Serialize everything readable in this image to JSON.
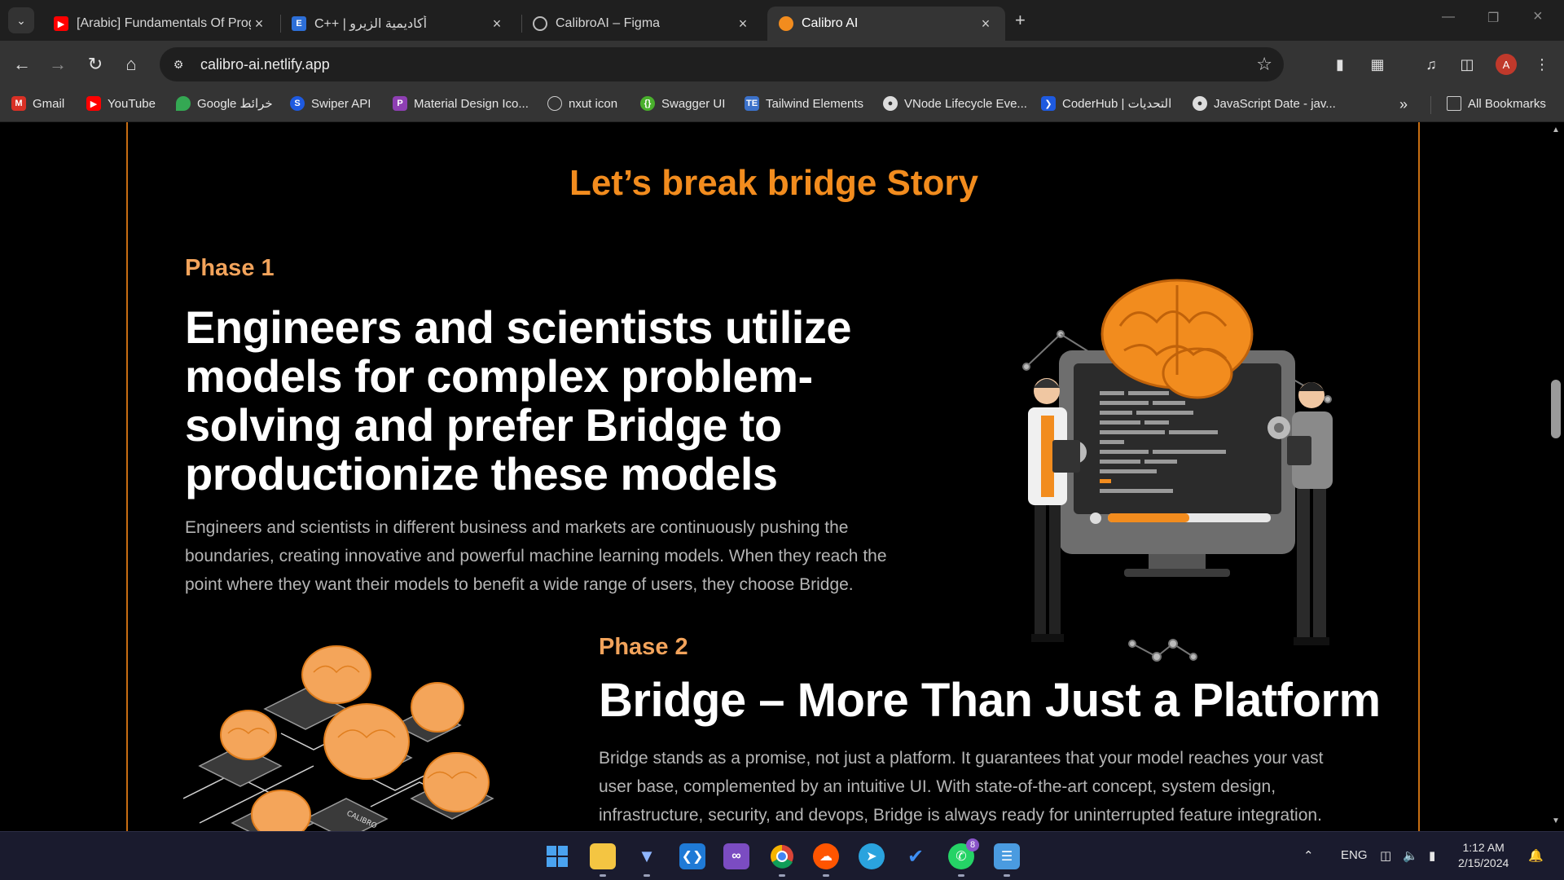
{
  "browser": {
    "tabs": [
      {
        "title": "[Arabic] Fundamentals Of Programming",
        "favicon": "youtube-icon",
        "color": "#ff0000"
      },
      {
        "title": "C++ | أكاديمية الزيرو",
        "favicon": "e-letter-icon",
        "color": "#2d6fd8"
      },
      {
        "title": "CalibroAI – Figma",
        "favicon": "figma-icon",
        "color": "#444"
      },
      {
        "title": "Calibro AI",
        "favicon": "calibro-icon",
        "color": "#f28c1e"
      }
    ],
    "address": "calibro-ai.netlify.app",
    "profile_initial": "A",
    "bookmarks": [
      {
        "label": "Gmail",
        "icon": "gmail-icon",
        "color": "#d93025"
      },
      {
        "label": "YouTube",
        "icon": "youtube-icon",
        "color": "#ff0000"
      },
      {
        "label": "Google خرائط",
        "icon": "maps-pin-icon",
        "color": "#34a853"
      },
      {
        "label": "Swiper API",
        "icon": "swiper-icon",
        "color": "#1e5ae0"
      },
      {
        "label": "Material Design Ico...",
        "icon": "material-design-icon",
        "color": "#8e3fb3"
      },
      {
        "label": "nxut icon",
        "icon": "nxut-icon",
        "color": "#555"
      },
      {
        "label": "Swagger UI",
        "icon": "swagger-icon",
        "color": "#49b02c"
      },
      {
        "label": "Tailwind Elements",
        "icon": "tailwind-elements-icon",
        "color": "#3b71ca"
      },
      {
        "label": "VNode Lifecycle Eve...",
        "icon": "globe-icon",
        "color": "#555"
      },
      {
        "label": "CoderHub | التحديات",
        "icon": "coderhub-icon",
        "color": "#1e5ae0"
      },
      {
        "label": "JavaScript Date - jav...",
        "icon": "globe-icon",
        "color": "#555"
      }
    ],
    "all_bookmarks_label": "All Bookmarks"
  },
  "page": {
    "section_title": "Let’s break bridge Story",
    "phase1": {
      "label": "Phase 1",
      "heading_lines": [
        "Engineers and scientists utilize",
        "models for complex problem-",
        "solving and prefer Bridge to",
        "productionize these models"
      ],
      "body_lines": [
        "Engineers and scientists in different business and markets are continuously pushing the",
        "boundaries, creating innovative and powerful machine learning models. When they reach the",
        "point where they want their models to benefit a wide range of users, they choose Bridge."
      ]
    },
    "phase2": {
      "label": "Phase 2",
      "heading": "Bridge – More Than Just a Platform",
      "body_lines": [
        "Bridge stands as a promise, not just a platform. It guarantees that your model reaches your vast",
        "user base, complemented by an intuitive UI. With state-of-the-art concept, system design,",
        "infrastructure, security, and devops, Bridge is always ready for uninterrupted feature integration."
      ],
      "chip_label": "CALIBRO"
    },
    "accent_color": "#f28c1e"
  },
  "taskbar": {
    "whatsapp_badge": "8",
    "language": "ENG",
    "time": "1:12 AM",
    "date": "2/15/2024"
  }
}
